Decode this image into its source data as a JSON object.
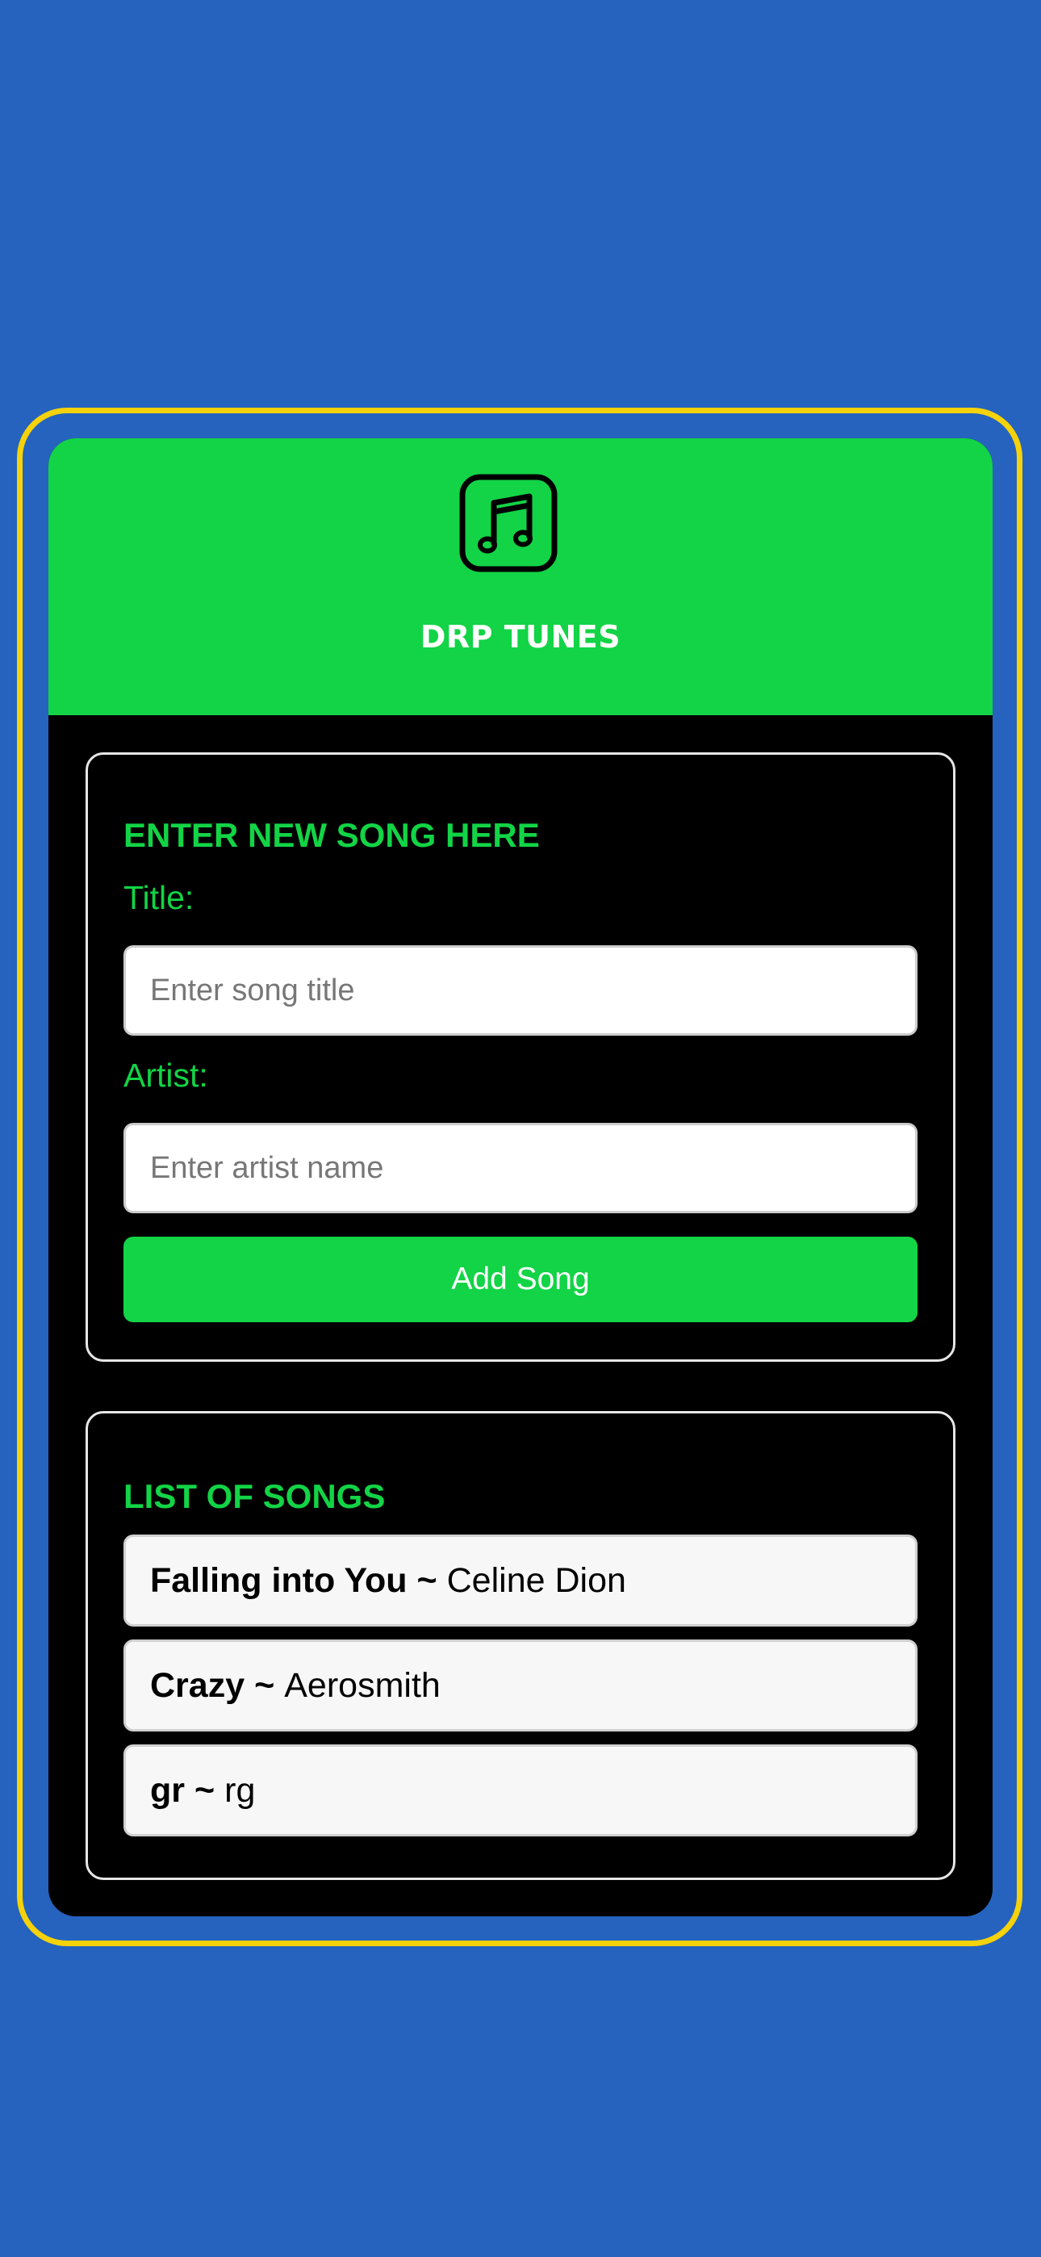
{
  "header": {
    "app_title": "DRP TUNES",
    "logo_icon": "music-note-icon"
  },
  "form": {
    "heading": "ENTER NEW SONG HERE",
    "title_label": "Title:",
    "title_placeholder": "Enter song title",
    "title_value": "",
    "artist_label": "Artist:",
    "artist_placeholder": "Enter artist name",
    "artist_value": "",
    "submit_label": "Add Song"
  },
  "song_list": {
    "heading": "LIST OF SONGS",
    "separator": "~",
    "items": [
      {
        "title": "Falling into You",
        "artist": "Celine Dion"
      },
      {
        "title": "Crazy",
        "artist": "Aerosmith"
      },
      {
        "title": "gr",
        "artist": "rg"
      }
    ]
  },
  "colors": {
    "page_background": "#2563be",
    "frame_border": "#f5d20a",
    "accent_green": "#12d446",
    "card_background": "#000000"
  }
}
